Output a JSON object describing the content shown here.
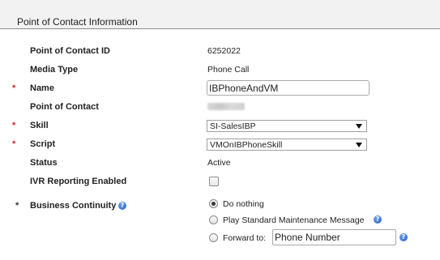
{
  "section": {
    "title": "Point of Contact Information"
  },
  "fields": {
    "poc_id": {
      "label": "Point of Contact ID",
      "value": "6252022"
    },
    "media_type": {
      "label": "Media Type",
      "value": "Phone Call"
    },
    "name": {
      "required_mark": "*",
      "label": "Name",
      "value": "IBPhoneAndVM"
    },
    "point_of_contact": {
      "label": "Point of Contact"
    },
    "skill": {
      "required_mark": "*",
      "label": "Skill",
      "selected": "SI-SalesIBP"
    },
    "script": {
      "required_mark": "*",
      "label": "Script",
      "selected": "VMOnIBPhoneSkill"
    },
    "status": {
      "label": "Status",
      "value": "Active"
    },
    "ivr_reporting": {
      "label": "IVR Reporting Enabled",
      "checked": false
    },
    "business_continuity": {
      "required_mark": "*",
      "label": "Business Continuity",
      "options": [
        {
          "label": "Do nothing",
          "checked": true
        },
        {
          "label": "Play Standard Maintenance Message",
          "checked": false
        },
        {
          "label": "Forward to:",
          "checked": false
        }
      ],
      "forward_placeholder": "Phone Number"
    }
  },
  "icons": {
    "help": "help-circle-icon",
    "dropdown": "chevron-down-icon"
  },
  "colors": {
    "required_asterisk": "#c62828",
    "help_icon": "#2c62c2",
    "section_bg": "#f2f2f2"
  }
}
